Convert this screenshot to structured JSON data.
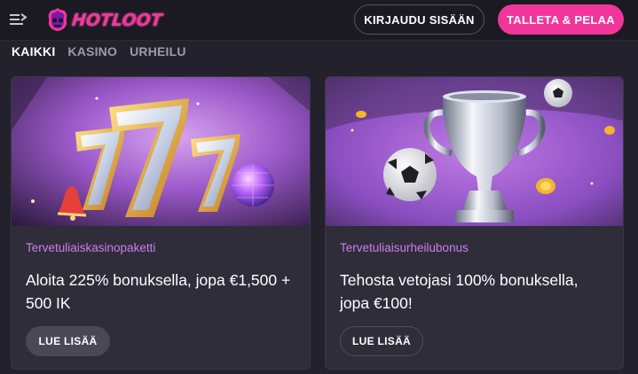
{
  "brand": {
    "logo_text": "HOTLOOT",
    "accent": "#f0369b"
  },
  "header": {
    "login_label": "KIRJAUDU SISÄÄN",
    "deposit_label": "TALLETA & PELAA"
  },
  "tabs": [
    {
      "label": "KAIKKI",
      "active": true
    },
    {
      "label": "KASINO",
      "active": false
    },
    {
      "label": "URHEILU",
      "active": false
    }
  ],
  "promos": [
    {
      "subtitle": "Tervetuliaiskasinopaketti",
      "title": "Aloita 225% bonuksella, jopa €1,500 + 500 IK",
      "button": "LUE LISÄÄ",
      "image": "slot-777-icon"
    },
    {
      "subtitle": "Tervetuliaisurheilubonus",
      "title": "Tehosta vetojasi 100% bonuksella, jopa €100!",
      "button": "LUE LISÄÄ",
      "image": "trophy-icon"
    }
  ]
}
